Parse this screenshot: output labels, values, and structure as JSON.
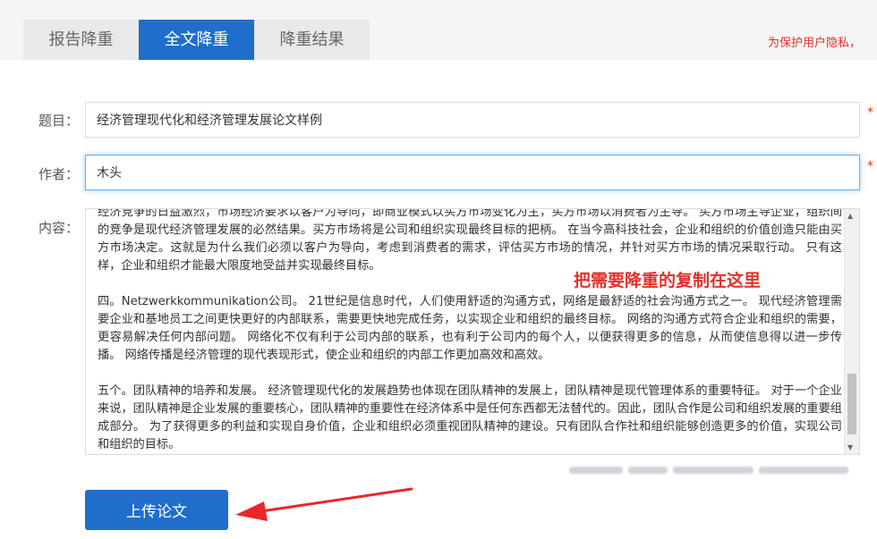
{
  "tabs": [
    {
      "label": "报告降重",
      "active": false
    },
    {
      "label": "全文降重",
      "active": true
    },
    {
      "label": "降重结果",
      "active": false
    }
  ],
  "notice": "为保护用户隐私，",
  "form": {
    "title_label": "题目：",
    "title_value": "经济管理现代化和经济管理发展论文样例",
    "author_label": "作者：",
    "author_value": "木头",
    "content_label": "内容：",
    "required_mark": "*",
    "paragraphs": [
      "经济竞争的日益激烈，市场经济要求以客户为导向，即商业模式以买方市场变化为主，买方市场以消费者为主导。 买方市场主导企业，组织间的竞争是现代经济管理发展的必然结果。买方市场将是公司和组织实现最终目标的把柄。 在当今高科技社会，企业和组织的价值创造只能由买方市场决定。这就是为什么我们必须以客户为导向，考虑到消费者的需求，评估买方市场的情况，并针对买方市场的情况采取行动。 只有这样，企业和组织才能最大限度地受益并实现最终目标。",
      "四。Netzwerkkommunikation公司。 21世纪是信息时代，人们使用舒适的沟通方式，网络是最舒适的社会沟通方式之一。 现代经济管理需要企业和基地员工之间更快更好的内部联系，需要更快地完成任务，以实现企业和组织的最终目标。 网络的沟通方式符合企业和组织的需要，更容易解决任何内部问题。 网络化不仅有利于公司内部的联系，也有利于公司内的每个人，以便获得更多的信息，从而使信息得以进一步传播。 网络传播是经济管理的现代表现形式，使企业和组织的内部工作更加高效和高效。",
      "五个。团队精神的培养和发展。 经济管理现代化的发展趋势也体现在团队精神的发展上，团队精神是现代管理体系的重要特征。 对于一个企业来说，团队精神是企业发展的重要核心，团队精神的重要性在经济体系中是任何东西都无法替代的。因此，团队合作是公司和组织发展的重要组成部分。 为了获得更多的利益和实现自身价值，企业和组织必须重视团队精神的建设。只有团队合作社和组织能够创造更多的价值，实现公司和组织的目标。"
    ]
  },
  "annotation": "把需要降重的复制在这里",
  "upload_button": "上传论文",
  "colors": {
    "accent": "#1f6ecc",
    "annotation": "#e0322c",
    "arrow": "#e8282a"
  },
  "icons": {
    "scroll_up": "triangle-up",
    "scroll_down": "triangle-down"
  }
}
